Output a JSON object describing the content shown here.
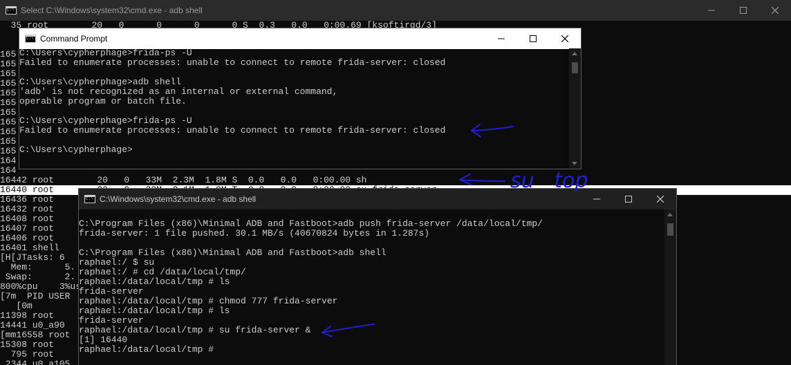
{
  "background_window": {
    "title": "Select C:\\Windows\\system32\\cmd.exe - adb  shell",
    "lines": [
      "  35 root        20   0      0      0      0 S  0.3   0.0   0:00.69 [ksoftirqd/3]",
      "",
      "",
      "165",
      "165",
      "165",
      "165",
      "165",
      "165",
      "165",
      "165",
      "165",
      "165",
      "165",
      "164",
      "164",
      "16442 root        20   0   33M  2.3M  1.8M S  0.0   0.0   0:00.00 sh",
      "16440 root        20   0   33M  2.1M  1.8M T  0.0   0.0   0:00.00 su frida-server",
      "16436 root",
      "16432 root",
      "16408 root",
      "16407 root",
      "16406 root",
      "16401 shell",
      "[H[JTasks: 6",
      "  Mem:      5.",
      " Swap:      2.",
      "800%cpu    3%us",
      "[7m  PID USER",
      "   [0m",
      "11398 root",
      "14441 u0_a90",
      "[mm16558 root",
      "15308 root",
      "  795 root",
      " 2344 u0_a105          20   0  3.8G  251M  170M S  0.6   4.2   0:16.75 com.android.systemui"
    ]
  },
  "window_a": {
    "title": "Command Prompt",
    "lines": [
      "C:\\Users\\cypherphage>frida-ps -U",
      "Failed to enumerate processes: unable to connect to remote frida-server: closed",
      "",
      "C:\\Users\\cypherphage>adb shell",
      "'adb' is not recognized as an internal or external command,",
      "operable program or batch file.",
      "",
      "C:\\Users\\cypherphage>frida-ps -U",
      "Failed to enumerate processes: unable to connect to remote frida-server: closed",
      "",
      "C:\\Users\\cypherphage>"
    ]
  },
  "window_b": {
    "title": "C:\\Windows\\system32\\cmd.exe - adb  shell",
    "lines": [
      "",
      "C:\\Program Files (x86)\\Minimal ADB and Fastboot>adb push frida-server /data/local/tmp/",
      "frida-server: 1 file pushed. 30.1 MB/s (40670824 bytes in 1.287s)",
      "",
      "C:\\Program Files (x86)\\Minimal ADB and Fastboot>adb shell",
      "raphael:/ $ su",
      "raphael:/ # cd /data/local/tmp/",
      "raphael:/data/local/tmp # ls",
      "frida-server",
      "raphael:/data/local/tmp # chmod 777 frida-server",
      "raphael:/data/local/tmp # ls",
      "frida-server",
      "raphael:/data/local/tmp # su frida-server &",
      "[1] 16440",
      "raphael:/data/local/tmp #"
    ]
  },
  "annotation_text": "su   top",
  "colors": {
    "console_bg": "#0c0c0c",
    "console_text": "#cccccc",
    "annotation_ink": "#1f1fd6"
  }
}
